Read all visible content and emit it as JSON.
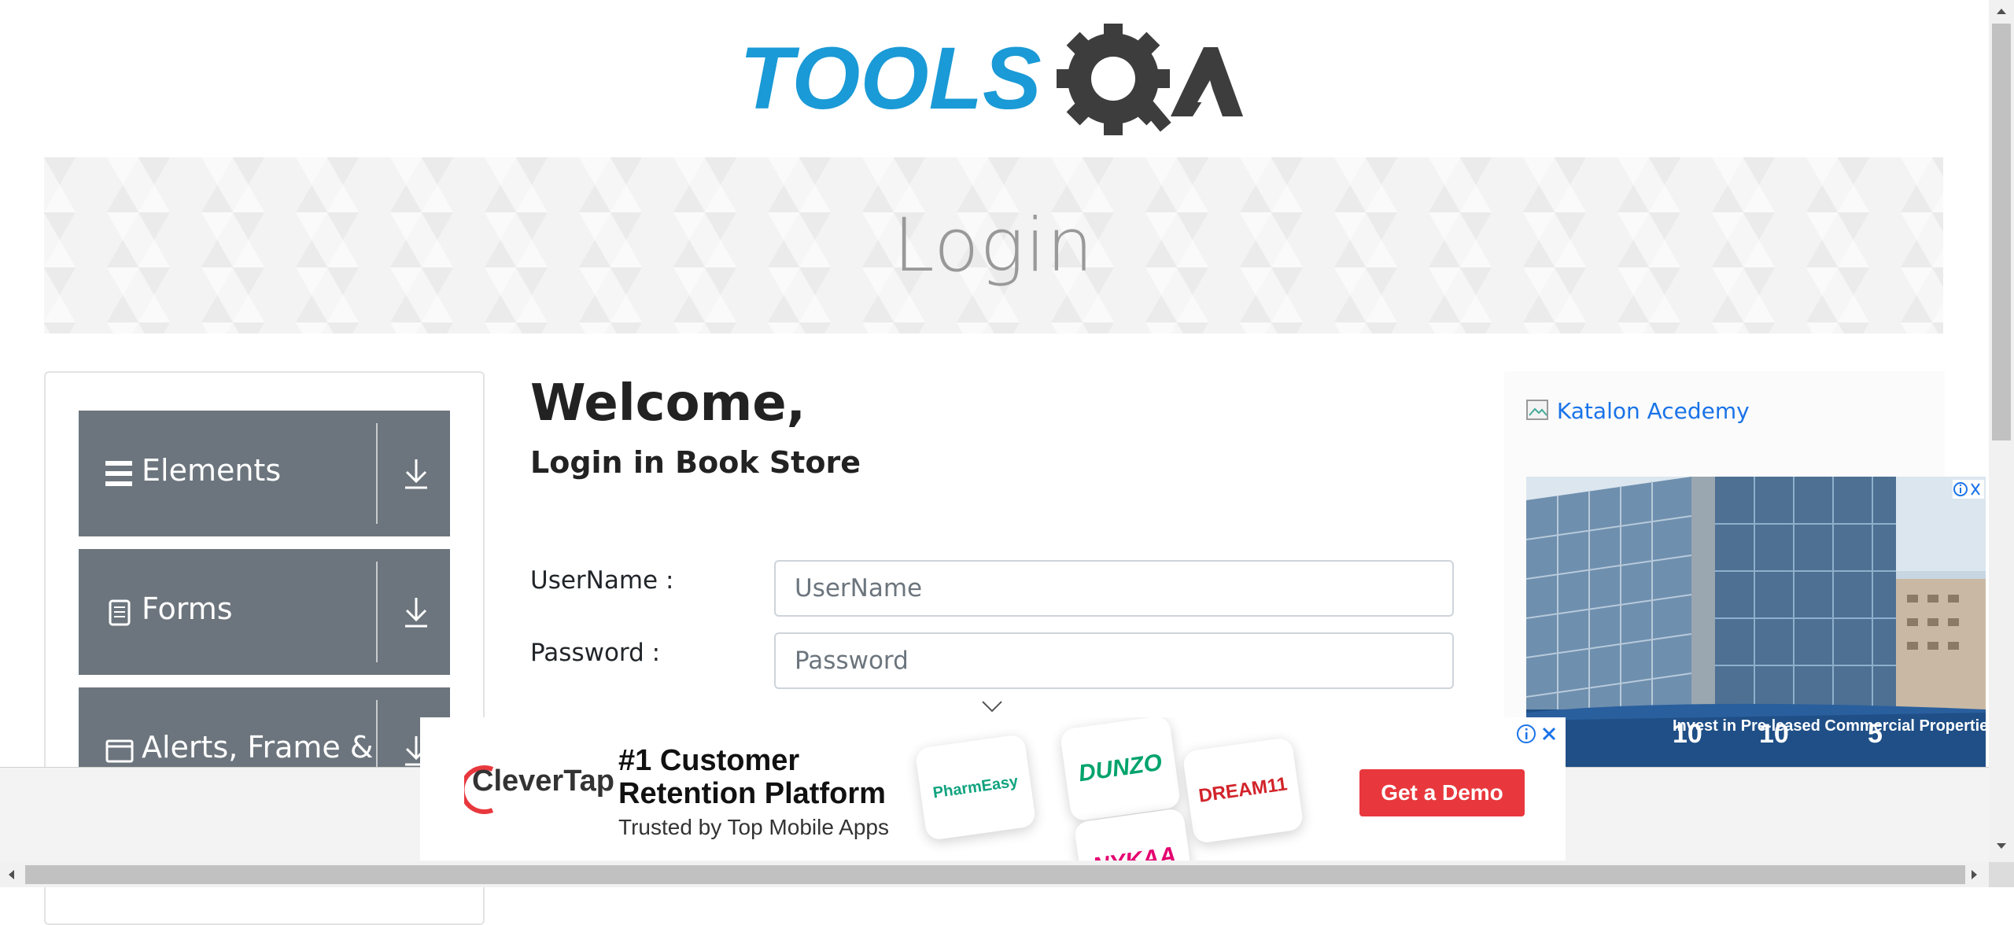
{
  "logo": {
    "text_tools": "TOOLS",
    "text_qa": "QA",
    "colors": {
      "tools": "#1a9ad6",
      "qa": "#3d3d3d"
    }
  },
  "banner": {
    "title": "Login"
  },
  "sidebar": {
    "groups": [
      {
        "label": "Elements",
        "icon": "hamburger-icon"
      },
      {
        "label": "Forms",
        "icon": "document-icon"
      },
      {
        "label": "Alerts, Frame &",
        "icon": "window-icon"
      }
    ]
  },
  "main": {
    "welcome": "Welcome,",
    "subtitle": "Login in Book Store",
    "username_label": "UserName :",
    "username_placeholder": "UserName",
    "password_label": "Password :",
    "password_placeholder": "Password"
  },
  "right_ad": {
    "katalon_alt": "Katalon Acedemy",
    "caption": "Invest in Pre-leased Commercial Properties",
    "numbers": [
      "10",
      "10",
      "5"
    ]
  },
  "bottom_ad": {
    "logo": "CleverTap",
    "headline_1": "#1 Customer",
    "headline_2": "Retention Platform",
    "sub": "Trusted by Top Mobile Apps",
    "tiles": [
      "PharmEasy",
      "DUNZO",
      "DREAM11",
      "NYKAA"
    ],
    "cta": "Get a Demo"
  },
  "colors": {
    "sidebar_group": "#6c757d",
    "cta": "#e8383d",
    "link": "#1a73e8"
  }
}
